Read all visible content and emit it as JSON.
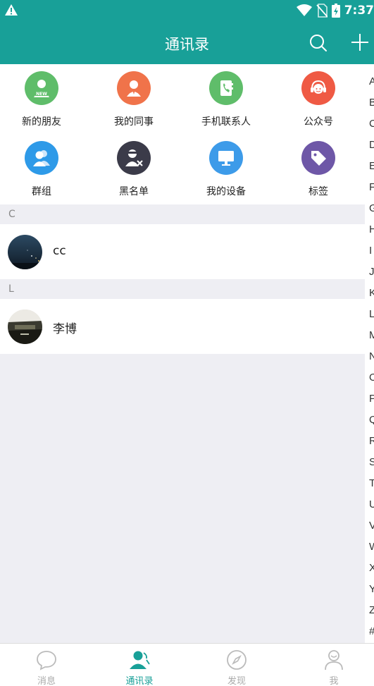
{
  "status_bar": {
    "time": "7:37"
  },
  "app_bar": {
    "title": "通讯录"
  },
  "shortcuts": [
    {
      "label": "新的朋友",
      "icon": "new-friend-icon",
      "color": "#5fbd6a"
    },
    {
      "label": "我的同事",
      "icon": "colleague-icon",
      "color": "#f0734a"
    },
    {
      "label": "手机联系人",
      "icon": "phone-contacts-icon",
      "color": "#5fbd6a"
    },
    {
      "label": "公众号",
      "icon": "official-account-icon",
      "color": "#ef5a44"
    },
    {
      "label": "群组",
      "icon": "group-icon",
      "color": "#2e9ae8"
    },
    {
      "label": "黑名单",
      "icon": "blacklist-icon",
      "color": "#3b3b49"
    },
    {
      "label": "我的设备",
      "icon": "device-icon",
      "color": "#3d9be9"
    },
    {
      "label": "标签",
      "icon": "tag-icon",
      "color": "#6e57a7"
    }
  ],
  "sections": [
    {
      "header": "C",
      "contacts": [
        {
          "name": "cc"
        }
      ]
    },
    {
      "header": "L",
      "contacts": [
        {
          "name": "李博"
        }
      ]
    }
  ],
  "index_letters": [
    "A",
    "B",
    "C",
    "D",
    "E",
    "F",
    "G",
    "H",
    "I",
    "J",
    "K",
    "L",
    "M",
    "N",
    "O",
    "P",
    "Q",
    "R",
    "S",
    "T",
    "U",
    "V",
    "W",
    "X",
    "Y",
    "Z",
    "#"
  ],
  "bottom_nav": [
    {
      "label": "消息",
      "icon": "chat-bubble-icon",
      "active": false
    },
    {
      "label": "通讯录",
      "icon": "contacts-icon",
      "active": true
    },
    {
      "label": "发现",
      "icon": "compass-icon",
      "active": false
    },
    {
      "label": "我",
      "icon": "person-icon",
      "active": false
    }
  ],
  "colors": {
    "primary": "#18a098",
    "inactive": "#aaaaaa"
  }
}
